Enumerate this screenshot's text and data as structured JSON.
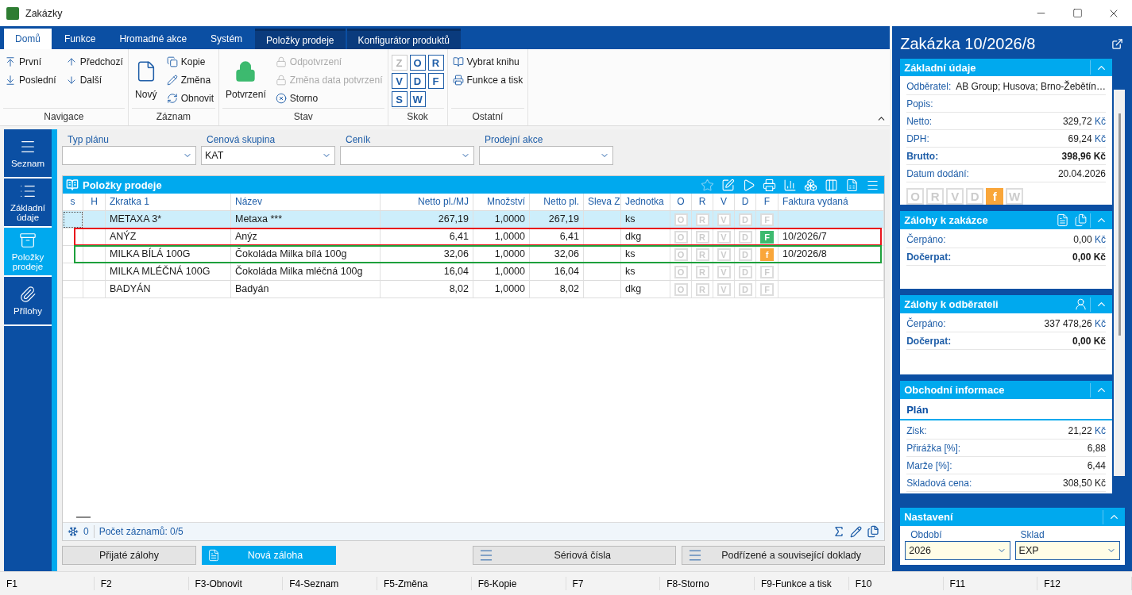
{
  "window": {
    "title": "Zakázky"
  },
  "ribbon": {
    "tabs": [
      {
        "label": "Domů",
        "selected": true,
        "kind": "main"
      },
      {
        "label": "Funkce",
        "selected": false,
        "kind": "main"
      },
      {
        "label": "Hromadné akce",
        "selected": false,
        "kind": "main"
      },
      {
        "label": "Systém",
        "selected": false,
        "kind": "main"
      },
      {
        "label": "Položky prodeje",
        "selected": false,
        "kind": "context"
      },
      {
        "label": "Konfigurátor produktů",
        "selected": false,
        "kind": "context"
      }
    ],
    "groups": [
      {
        "label": "Navigace",
        "items": [
          {
            "label": "První",
            "kind": "small",
            "disabled": false
          },
          {
            "label": "Poslední",
            "kind": "small",
            "disabled": false
          },
          {
            "label": "Předchozí",
            "kind": "small",
            "disabled": false
          },
          {
            "label": "Další",
            "kind": "small",
            "disabled": false
          }
        ]
      },
      {
        "label": "Záznam",
        "items": [
          {
            "label": "Nový",
            "kind": "large",
            "disabled": false
          },
          {
            "label": "Kopie",
            "kind": "small",
            "disabled": false
          },
          {
            "label": "Změna",
            "kind": "small",
            "disabled": false
          },
          {
            "label": "Obnovit",
            "kind": "small",
            "disabled": false
          }
        ]
      },
      {
        "label": "Stav",
        "items": [
          {
            "label": "Potvrzení",
            "kind": "large",
            "disabled": false
          },
          {
            "label": "Odpotvrzení",
            "kind": "small",
            "disabled": true
          },
          {
            "label": "Změna data potvrzení",
            "kind": "small",
            "disabled": true
          },
          {
            "label": "Storno",
            "kind": "small",
            "disabled": false
          }
        ]
      },
      {
        "label": "Skok",
        "items": [
          {
            "label": "Z",
            "kind": "letter",
            "disabled": true
          },
          {
            "label": "O",
            "kind": "letter",
            "disabled": false
          },
          {
            "label": "R",
            "kind": "letter",
            "disabled": false
          },
          {
            "label": "V",
            "kind": "letter",
            "disabled": false
          },
          {
            "label": "D",
            "kind": "letter",
            "disabled": false
          },
          {
            "label": "F",
            "kind": "letter",
            "disabled": false
          },
          {
            "label": "S",
            "kind": "letter",
            "disabled": false
          },
          {
            "label": "W",
            "kind": "letter",
            "disabled": false
          }
        ]
      },
      {
        "label": "Ostatní",
        "items": [
          {
            "label": "Vybrat knihu",
            "kind": "small",
            "disabled": false
          },
          {
            "label": "Funkce a tisk",
            "kind": "small",
            "disabled": false
          }
        ]
      }
    ]
  },
  "nav": [
    {
      "label": "Seznam",
      "selected": false
    },
    {
      "label": "Základní údaje",
      "selected": false
    },
    {
      "label": "Položky prodeje",
      "selected": true
    },
    {
      "label": "Přílohy",
      "selected": false
    }
  ],
  "filters": [
    {
      "label": "Typ plánu"
    },
    {
      "label": "Cenová skupina",
      "value": "KAT"
    },
    {
      "label": "Ceník"
    },
    {
      "label": "Prodejní akce"
    }
  ],
  "grid": {
    "title": "Položky prodeje",
    "columns": [
      "s",
      "H",
      "Zkratka 1",
      "Název",
      "Netto pl./MJ",
      "Množství",
      "Netto pl.",
      "Sleva Z",
      "Jednotka",
      "O",
      "R",
      "V",
      "D",
      "F",
      "Faktura vydaná"
    ],
    "rows": [
      {
        "selected": true,
        "zkratka": "METAXA 3*",
        "nazev": "Metaxa ***",
        "netto_mj": "267,19",
        "mnozstvi": "1,0000",
        "netto": "267,19",
        "jednotka": "ks",
        "marks": [
          {
            "label": "O",
            "active": false
          },
          {
            "label": "R",
            "active": false
          },
          {
            "label": "V",
            "active": false
          },
          {
            "label": "D",
            "active": false
          },
          {
            "label": "F",
            "active": false
          }
        ]
      },
      {
        "selected": false,
        "color": "#e8141b",
        "zkratka": "ANÝZ",
        "nazev": "Anýz",
        "netto_mj": "6,41",
        "mnozstvi": "1,0000",
        "netto": "6,41",
        "jednotka": "dkg",
        "marks": [
          {
            "label": "O",
            "active": false
          },
          {
            "label": "R",
            "active": false
          },
          {
            "label": "V",
            "active": false
          },
          {
            "label": "D",
            "active": false
          },
          {
            "label": "F",
            "active": true,
            "color": "#3dba6f"
          }
        ],
        "faktura": "10/2026/7"
      },
      {
        "selected": false,
        "color": "#1ea03c",
        "zkratka": "MILKA BÍLÁ 100G",
        "nazev": "Čokoláda Milka bílá 100g",
        "netto_mj": "32,06",
        "mnozstvi": "1,0000",
        "netto": "32,06",
        "jednotka": "ks",
        "marks": [
          {
            "label": "O",
            "active": false
          },
          {
            "label": "R",
            "active": false
          },
          {
            "label": "V",
            "active": false
          },
          {
            "label": "D",
            "active": false
          },
          {
            "label": "f",
            "active": true,
            "color": "#f9a63a"
          }
        ],
        "faktura": "10/2026/8"
      },
      {
        "selected": false,
        "zkratka": "MILKA MLÉČNÁ 100G",
        "nazev": "Čokoláda Milka mléčná 100g",
        "netto_mj": "16,04",
        "mnozstvi": "1,0000",
        "netto": "16,04",
        "jednotka": "ks",
        "marks": [
          {
            "label": "O",
            "active": false
          },
          {
            "label": "R",
            "active": false
          },
          {
            "label": "V",
            "active": false
          },
          {
            "label": "D",
            "active": false
          },
          {
            "label": "F",
            "active": false
          }
        ]
      },
      {
        "selected": false,
        "zkratka": "BADYÁN",
        "nazev": "Badyán",
        "netto_mj": "8,02",
        "mnozstvi": "1,0000",
        "netto": "8,02",
        "jednotka": "dkg",
        "marks": [
          {
            "label": "O",
            "active": false
          },
          {
            "label": "R",
            "active": false
          },
          {
            "label": "V",
            "active": false
          },
          {
            "label": "D",
            "active": false
          },
          {
            "label": "F",
            "active": false
          }
        ]
      }
    ],
    "footer": {
      "count": "0",
      "records": "Počet záznamů: 0/5"
    }
  },
  "buttons": [
    {
      "label": "Přijaté zálohy",
      "kind": "plain"
    },
    {
      "label": "Nová záloha",
      "kind": "primary"
    },
    {
      "label": "Sériová čísla",
      "kind": "list"
    },
    {
      "label": "Podřízené a související doklady",
      "kind": "list"
    }
  ],
  "panel": {
    "title": "Zakázka 10/2026/8",
    "sections": [
      {
        "title": "Základní údaje",
        "rows": [
          {
            "label": "Odběratel:",
            "value": "AB Group; Husova; Brno-Žebětín…",
            "kind": "inline",
            "bold": false
          },
          {
            "label": "Popis:",
            "kind": "inline",
            "bold": false
          },
          {
            "label": "Netto:",
            "value": "329,72",
            "unit": "Kč",
            "kind": "amount",
            "bold": false
          },
          {
            "label": "DPH:",
            "value": "69,24",
            "unit": "Kč",
            "kind": "amount",
            "bold": false
          },
          {
            "label": "Brutto:",
            "value": "398,96 Kč",
            "kind": "amount",
            "bold": true
          },
          {
            "label": "Datum dodání:",
            "value": "20.04.2026",
            "kind": "amount",
            "bold": false
          }
        ],
        "marks": [
          {
            "label": "O",
            "active": false
          },
          {
            "label": "R",
            "active": false
          },
          {
            "label": "V",
            "active": false
          },
          {
            "label": "D",
            "active": false
          },
          {
            "label": "f",
            "active": true,
            "color": "#f9a63a"
          },
          {
            "label": "W",
            "active": false
          }
        ]
      },
      {
        "title": "Zálohy k zakázce",
        "rows": [
          {
            "label": "Čerpáno:",
            "value": "0,00",
            "unit": "Kč",
            "kind": "amount",
            "bold": false
          },
          {
            "label": "Dočerpat:",
            "value": "0,00 Kč",
            "kind": "amount",
            "bold": true
          }
        ]
      },
      {
        "title": "Zálohy k odběrateli",
        "rows": [
          {
            "label": "Čerpáno:",
            "value": "337 478,26",
            "unit": "Kč",
            "kind": "amount",
            "bold": false
          },
          {
            "label": "Dočerpat:",
            "value": "0,00 Kč",
            "kind": "amount",
            "bold": true
          }
        ]
      },
      {
        "title": "Obchodní informace",
        "subtitle": "Plán",
        "rows": [
          {
            "label": "Zisk:",
            "value": "21,22",
            "unit": "Kč",
            "kind": "amount",
            "bold": false
          },
          {
            "label": "Přirážka [%]:",
            "value": "6,88",
            "kind": "amount",
            "bold": false
          },
          {
            "label": "Marže [%]:",
            "value": "6,44",
            "kind": "amount",
            "bold": false
          },
          {
            "label": "Skladová cena:",
            "value": "308,50 Kč",
            "kind": "amount",
            "bold": false
          }
        ]
      }
    ],
    "settings": {
      "title": "Nastavení",
      "fields": [
        {
          "label": "Období",
          "value": "2026"
        },
        {
          "label": "Sklad",
          "value": "EXP"
        }
      ]
    }
  },
  "function_keys": [
    "F1",
    "F2",
    "F3-Obnovit",
    "F4-Seznam",
    "F5-Změna",
    "F6-Kopie",
    "F7",
    "F8-Storno",
    "F9-Funkce a tisk",
    "F10",
    "F11",
    "F12"
  ]
}
